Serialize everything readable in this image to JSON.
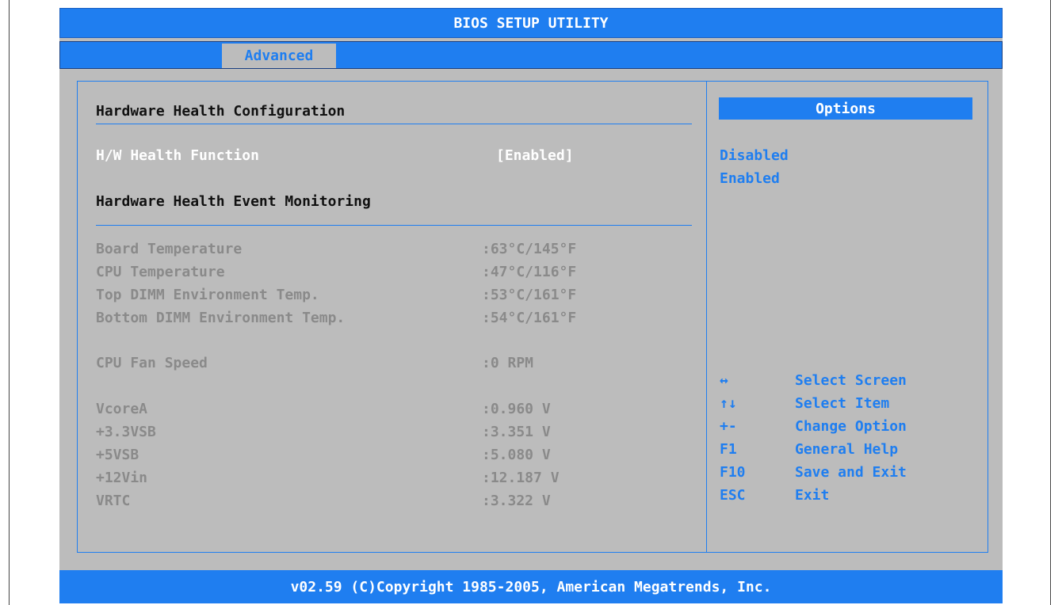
{
  "title": "BIOS SETUP UTILITY",
  "tabs": [
    {
      "label": "Advanced"
    }
  ],
  "main": {
    "section_title": "Hardware Health Configuration",
    "hw_function": {
      "label": "H/W Health Function",
      "value": "[Enabled]"
    },
    "monitor_title": "Hardware Health Event Monitoring",
    "temps": [
      {
        "label": "Board Temperature",
        "value": ":63°C/145°F"
      },
      {
        "label": "CPU Temperature",
        "value": ":47°C/116°F"
      },
      {
        "label": "Top DIMM Environment Temp.",
        "value": ":53°C/161°F"
      },
      {
        "label": "Bottom DIMM Environment Temp.",
        "value": ":54°C/161°F"
      }
    ],
    "fan": {
      "label": "CPU Fan Speed",
      "value": ":0 RPM"
    },
    "voltages": [
      {
        "label": "VcoreA",
        "value": ":0.960 V"
      },
      {
        "label": "+3.3VSB",
        "value": ":3.351 V"
      },
      {
        "label": "+5VSB",
        "value": ":5.080 V"
      },
      {
        "label": "+12Vin",
        "value": ":12.187 V"
      },
      {
        "label": "VRTC",
        "value": ":3.322 V"
      }
    ]
  },
  "options": {
    "title": "Options",
    "items": [
      "Disabled",
      "Enabled"
    ]
  },
  "help": [
    {
      "key": "↔",
      "action": "Select Screen"
    },
    {
      "key": "↑↓",
      "action": "Select Item"
    },
    {
      "key": "+-",
      "action": "Change Option"
    },
    {
      "key": "F1",
      "action": "General Help"
    },
    {
      "key": "F10",
      "action": "Save and Exit"
    },
    {
      "key": "ESC",
      "action": "Exit"
    }
  ],
  "footer": "v02.59 (C)Copyright 1985-2005, American Megatrends, Inc.",
  "colors": {
    "accent": "#1f7ef0",
    "background": "#bcbcbc",
    "dim_text": "#8a8a8a"
  }
}
